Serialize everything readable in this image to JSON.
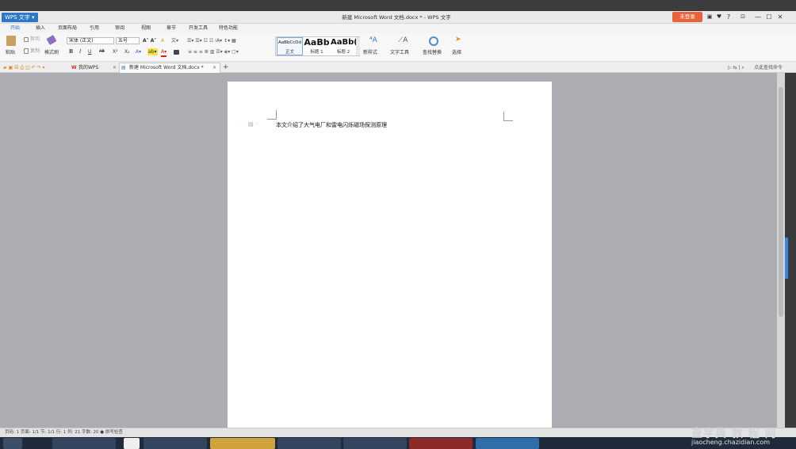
{
  "app": {
    "menu_button": "WPS 文字 ▾",
    "window_title": "新建 Microsoft Word 文档.docx * - WPS 文字",
    "login_button": "未登录",
    "window_controls": [
      "?",
      "—",
      "☐",
      "✕"
    ]
  },
  "menu_tabs": [
    "开始",
    "插入",
    "页面布局",
    "引用",
    "审阅",
    "视图",
    "章节",
    "开发工具",
    "特色功能"
  ],
  "active_menu_tab": "开始",
  "ribbon": {
    "clipboard": {
      "paste": "粘贴",
      "cut": "剪切",
      "copy": "复制",
      "format_painter": "格式刷"
    },
    "font_name": "宋体 (正文)",
    "font_size": "五号",
    "bold": "B",
    "italic": "I",
    "underline": "U",
    "strike": "AB",
    "superscript": "X²",
    "subscript": "X₂",
    "styles": [
      {
        "preview": "AaBbCcDd",
        "label": "正文"
      },
      {
        "preview": "AaBb",
        "label": "标题 1"
      },
      {
        "preview": "AaBb(",
        "label": "标题 2"
      }
    ],
    "new_style": "新样式",
    "text_tools": "文字工具",
    "find_replace": "查找替换",
    "select": "选择"
  },
  "tabs": {
    "home_tab": "我的WPS",
    "doc_tab": "新建 Microsoft Word 文档.docx *",
    "add_tab": "+",
    "search_hint": "点此查找命令"
  },
  "document": {
    "body_text": "本文介绍了大气电厂和雷电闪烁磁场探测原理"
  },
  "status_bar": {
    "text": "页码: 1   页面: 1/1   节: 1/1   行: 1   列: 21   字数: 20   ● 拼写检查"
  },
  "watermark": {
    "line1": "查字典 教 程 网",
    "line2": "jiaocheng.chazidian.com"
  },
  "colors": {
    "accent": "#2e76c8",
    "login": "#e8633a",
    "workspace": "#acadb2",
    "page": "#ffffff"
  }
}
